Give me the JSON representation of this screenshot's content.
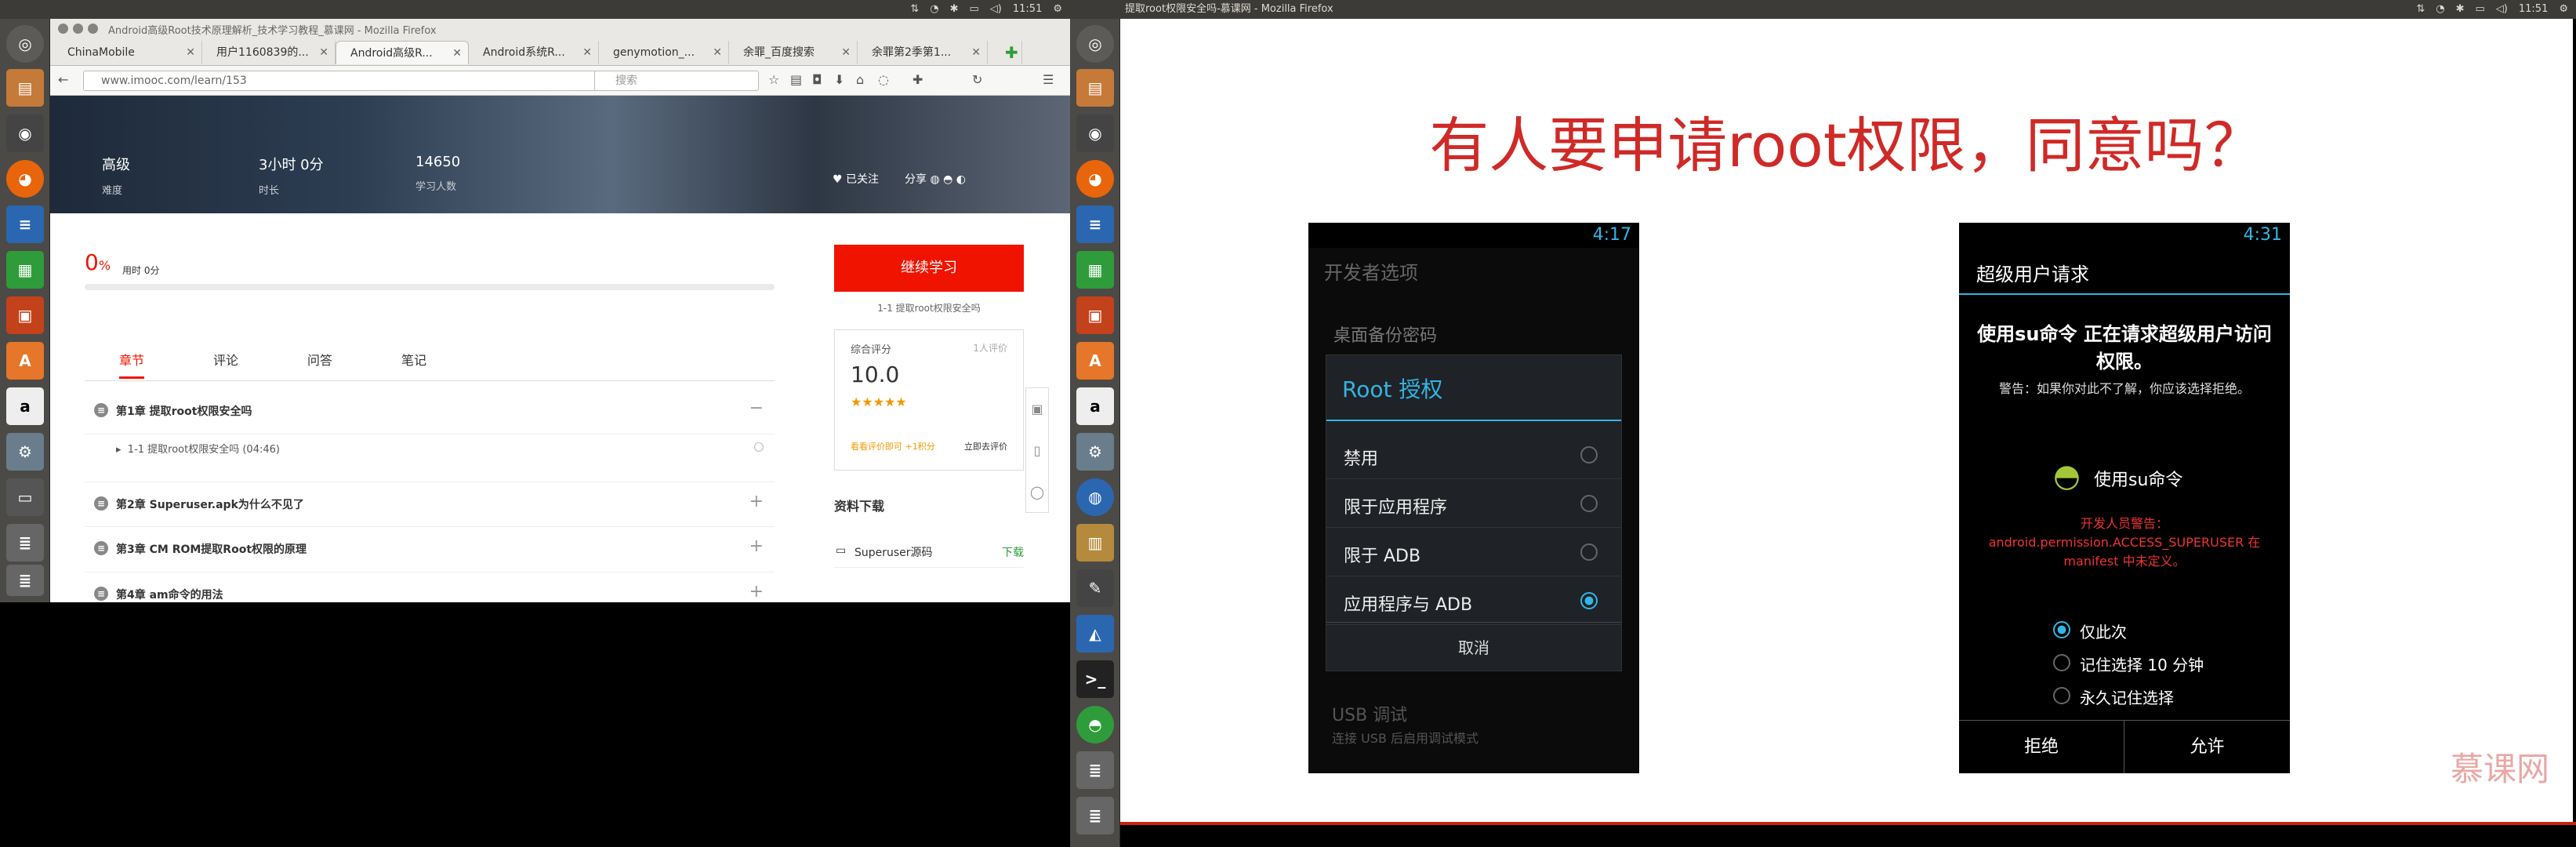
{
  "left_screen": {
    "topbar": {
      "title": "Android高级Root技术原理解析_技术学习教程_慕课网 - Mozilla Firefox",
      "time": "11:51"
    },
    "firefox": {
      "tabs": [
        {
          "label": "ChinaMobile"
        },
        {
          "label": "用户1160839的..."
        },
        {
          "label": "Android高级R..."
        },
        {
          "label": "Android系统R..."
        },
        {
          "label": "genymotion_..."
        },
        {
          "label": "余罪_百度搜索"
        },
        {
          "label": "余罪第2季第1..."
        }
      ],
      "url": "www.imooc.com/learn/153",
      "search_placeholder": "搜索"
    },
    "course": {
      "stats": [
        {
          "value": "高级",
          "label": "难度"
        },
        {
          "value": "3小时 0分",
          "label": "时长"
        },
        {
          "value": "14650",
          "label": "学习人数"
        }
      ],
      "follow": "已关注",
      "share": "分享",
      "progress_pct": "0",
      "progress_unit": "%",
      "used_time": "用时 0分",
      "progress": 0,
      "tabs": [
        "章节",
        "评论",
        "问答",
        "笔记"
      ],
      "chapters": [
        "第1章 提取root权限安全吗",
        "第2章 Superuser.apk为什么不见了",
        "第3章 CM ROM提取Root权限的原理",
        "第4章 am命令的用法"
      ],
      "lesson": "1-1 提取root权限安全吗 (04:46)",
      "continue_btn": "继续学习",
      "continue_sub": "1-1 提取root权限安全吗",
      "score_label": "综合评分",
      "score_count": "1人评价",
      "score": "10.0",
      "stars": "★★★★★",
      "score_hint": "看看评价即可 +1积分",
      "rate_now": "立即去评价",
      "download_title": "资料下载",
      "download_item": "Superuser源码",
      "download_link": "下载"
    }
  },
  "right_screen": {
    "topbar": {
      "title": "提取root权限安全吗-慕课网 - Mozilla Firefox",
      "time": "11:51"
    },
    "slide": {
      "title": "有人要申请root权限，同意吗？",
      "phone1": {
        "time": "4:17",
        "bg_title": "开发者选项",
        "bg_item": "桌面备份密码",
        "dialog_title": "Root 授权",
        "options": [
          "禁用",
          "限于应用程序",
          "限于 ADB",
          "应用程序与 ADB"
        ],
        "selected": 3,
        "cancel": "取消",
        "bg_usb": "USB 调试",
        "bg_usb_sub": "连接 USB 后启用调试模式"
      },
      "phone2": {
        "time": "4:31",
        "header": "超级用户请求",
        "request": "使用su命令 正在请求超级用户访问权限。",
        "warning": "警告：如果你对此不了解，你应该选择拒绝。",
        "app": "使用su命令",
        "dev_warning": "开发人员警告：android.permission.ACCESS_SUPERUSER 在 manifest 中未定义。",
        "options": [
          "仅此次",
          "记住选择 10 分钟",
          "永久记住选择"
        ],
        "deny": "拒绝",
        "allow": "允许"
      },
      "brand": "慕课网"
    }
  },
  "colors": {
    "accent": "#f01400",
    "slide_title": "#cf2a27",
    "holo_blue": "#33b5e5"
  }
}
